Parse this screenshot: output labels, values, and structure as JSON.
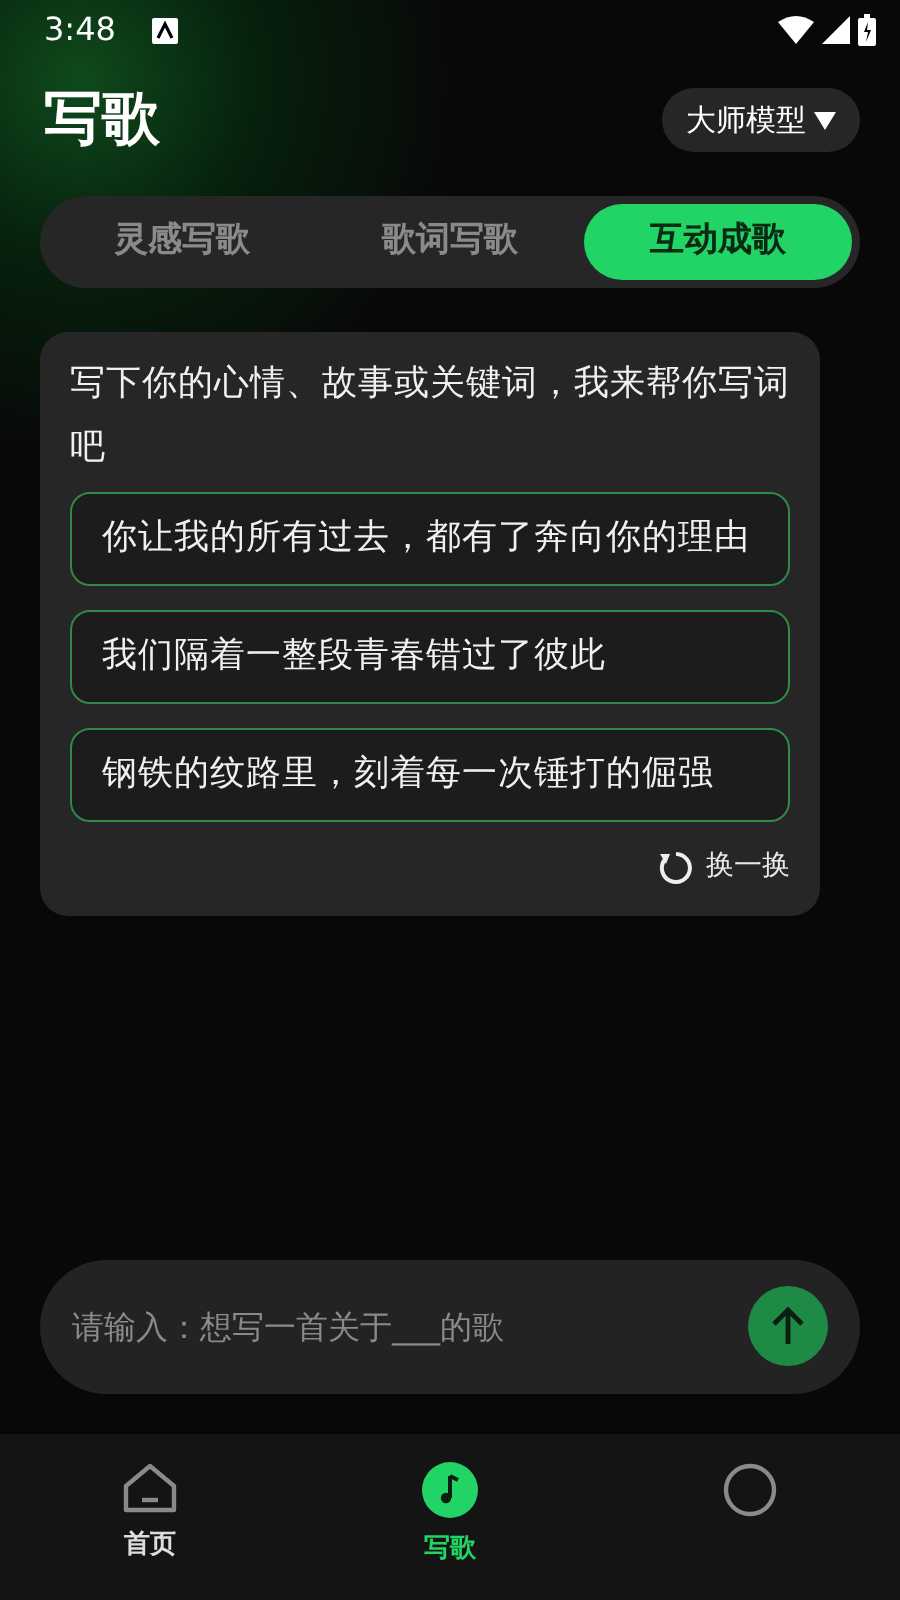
{
  "status_bar": {
    "time": "3:48"
  },
  "header": {
    "title": "写歌",
    "model_button": "大师模型"
  },
  "tabs": [
    {
      "label": "灵感写歌",
      "selected": false
    },
    {
      "label": "歌词写歌",
      "selected": false
    },
    {
      "label": "互动成歌",
      "selected": true
    }
  ],
  "prompt_card": {
    "intro": "写下你的心情、故事或关键词，我来帮你写词吧",
    "suggestions": [
      "你让我的所有过去，都有了奔向你的理由",
      "我们隔着一整段青春错过了彼此",
      "钢铁的纹路里，刻着每一次锤打的倔强"
    ],
    "refresh": "换一换"
  },
  "input": {
    "placeholder": "请输入：想写一首关于___的歌"
  },
  "bottom_nav": [
    {
      "kind": "home",
      "label": "首页",
      "selected": false
    },
    {
      "kind": "music",
      "label": "写歌",
      "selected": true
    },
    {
      "kind": "other",
      "selected": false
    }
  ]
}
